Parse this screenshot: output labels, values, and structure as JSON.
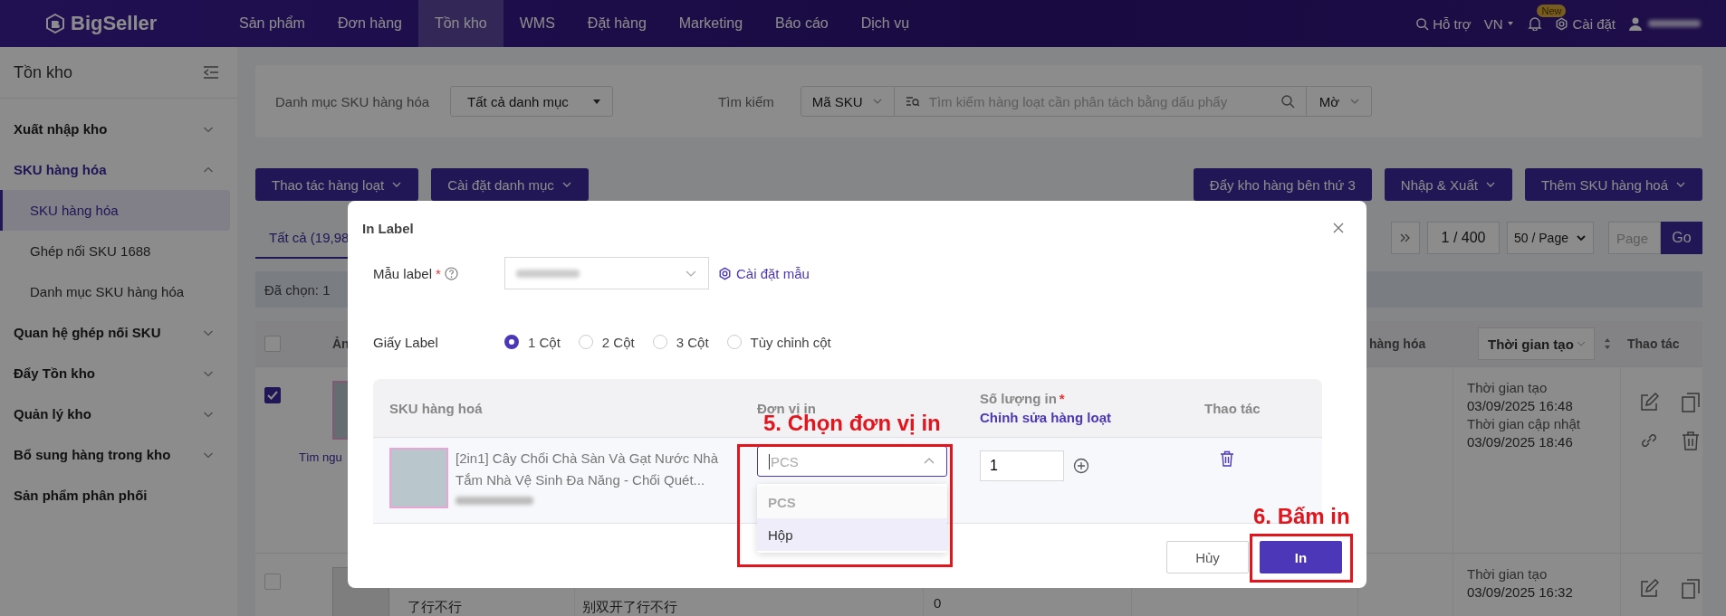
{
  "nav": {
    "logo": "BigSeller",
    "items": [
      {
        "label": "Sản phẩm",
        "selected": false
      },
      {
        "label": "Đơn hàng",
        "selected": false
      },
      {
        "label": "Tồn kho",
        "selected": true
      },
      {
        "label": "WMS",
        "selected": false
      },
      {
        "label": "Đặt hàng",
        "selected": false
      },
      {
        "label": "Marketing",
        "selected": false
      },
      {
        "label": "Báo cáo",
        "selected": false
      },
      {
        "label": "Dịch vụ",
        "selected": false
      }
    ],
    "help": "Hỗ trợ",
    "language": "VN",
    "badge": "New",
    "settings": "Cài đặt"
  },
  "sidebar": {
    "title": "Tồn kho",
    "items": [
      {
        "label": "Xuất nhập kho",
        "kind": "group",
        "expanded": false
      },
      {
        "label": "SKU hàng hóa",
        "kind": "group",
        "expanded": true,
        "children": [
          {
            "label": "SKU hàng hóa",
            "selected": true
          },
          {
            "label": "Ghép nối SKU 1688",
            "selected": false
          },
          {
            "label": "Danh mục SKU hàng hóa",
            "selected": false
          }
        ]
      },
      {
        "label": "Quan hệ ghép nối SKU",
        "kind": "group",
        "expanded": false
      },
      {
        "label": "Đẩy Tồn kho",
        "kind": "group",
        "expanded": false
      },
      {
        "label": "Quản lý kho",
        "kind": "group",
        "expanded": false
      },
      {
        "label": "Bổ sung hàng trong kho",
        "kind": "group",
        "expanded": false
      },
      {
        "label": "Sản phẩm phân phối",
        "kind": "link"
      }
    ]
  },
  "filters": {
    "category_label": "Danh mục SKU hàng hóa",
    "category_value": "Tất cả danh mục",
    "search_label": "Tìm kiếm",
    "search_field": "Mã SKU",
    "search_placeholder": "Tìm kiếm hàng loạt cần phân tách bằng dấu phẩy",
    "match_mode": "Mờ"
  },
  "toolbar": {
    "left": [
      {
        "label": "Thao tác hàng loạt",
        "dropdown": true
      },
      {
        "label": "Cài đặt danh mục",
        "dropdown": true
      }
    ],
    "right": [
      {
        "label": "Đẩy kho hàng bên thứ 3",
        "dropdown": false
      },
      {
        "label": "Nhập & Xuất",
        "dropdown": true
      },
      {
        "label": "Thêm SKU hàng hoá",
        "dropdown": true
      }
    ]
  },
  "tabs": [
    {
      "label": "Tất cả (19,98",
      "selected": true
    }
  ],
  "pagination": {
    "page": "1 / 400",
    "page_size": "50 / Page",
    "page_placeholder": "Page",
    "go": "Go"
  },
  "selection": "Đã chọn: 1",
  "table": {
    "header_checked": false,
    "columns": [
      {
        "label": "Ản",
        "kind": "plain"
      },
      {
        "label": "hàng hóa",
        "kind": "plain"
      },
      {
        "label": "Thời gian tạo",
        "kind": "sort"
      },
      {
        "label": "Thao tác",
        "kind": "plain"
      }
    ],
    "rows": [
      {
        "checked": true,
        "link": "Tìm ngu",
        "created_label": "Thời gian tạo",
        "created": "03/09/2025 16:48",
        "updated_label": "Thời gian cập nhật",
        "updated": "03/09/2025 18:46"
      },
      {
        "checked": false,
        "name": "了行不行",
        "column_4": "别双开了行不行",
        "column_5": "0",
        "created_label": "Thời gian tạo",
        "created": "03/09/2025 16:32"
      }
    ]
  },
  "modal": {
    "title": "In Label",
    "template_label": "Mẫu label",
    "template_required_mark": "*",
    "template_link": "Cài đặt mẫu",
    "paper_label": "Giấy Label",
    "paper_options": [
      {
        "label": "1 Cột",
        "selected": true
      },
      {
        "label": "2 Cột",
        "selected": false
      },
      {
        "label": "3 Cột",
        "selected": false
      },
      {
        "label": "Tùy chỉnh cột",
        "selected": false
      }
    ],
    "columns": [
      {
        "label": "SKU hàng hoá"
      },
      {
        "label": "Đơn vị in"
      },
      {
        "label": "Số lượng in",
        "required_mark": "*",
        "link": "Chỉnh sửa hàng loạt"
      },
      {
        "label": "Thao tác"
      }
    ],
    "rows": [
      {
        "name": "[2in1] Cây Chổi Chà Sàn Và Gạt Nước Nhà Tắm Nhà Vệ Sinh Đa Năng - Chổi Quét...",
        "unit_placeholder": "PCS",
        "dropdown_open": true,
        "unit_options": [
          {
            "label": "PCS",
            "disabled": true,
            "highlighted": false
          },
          {
            "label": "Hộp",
            "disabled": false,
            "highlighted": true
          }
        ],
        "quantity": "1"
      }
    ],
    "buttons": [
      {
        "label": "Hủy",
        "kind": "secondary"
      },
      {
        "label": "In",
        "kind": "primary"
      }
    ]
  },
  "annotations": [
    {
      "text": "5. Chọn đơn vị in",
      "kind": "unit"
    },
    {
      "text": "6. Bấm in",
      "kind": "print"
    }
  ]
}
